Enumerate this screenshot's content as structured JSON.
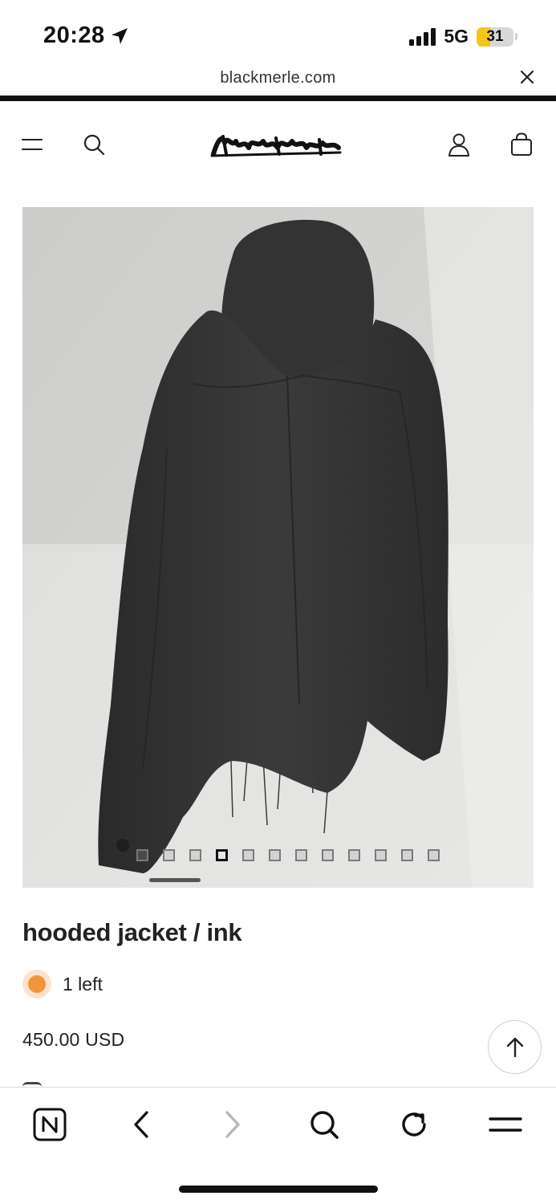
{
  "status_bar": {
    "time": "20:28",
    "network": "5G",
    "battery": "31"
  },
  "browser": {
    "url": "blackmerle.com"
  },
  "site": {
    "logo_text": "blackmerle"
  },
  "gallery": {
    "image_count": 12,
    "active_index": 4
  },
  "product": {
    "title": "hooded jacket / ink",
    "stock_text": "1 left",
    "stock_color": "#f2953a",
    "price": "450.00 USD"
  },
  "toolbar": {
    "items": [
      "news-icon",
      "back-icon",
      "forward-icon",
      "search-icon",
      "reload-icon",
      "menu-icon"
    ]
  }
}
